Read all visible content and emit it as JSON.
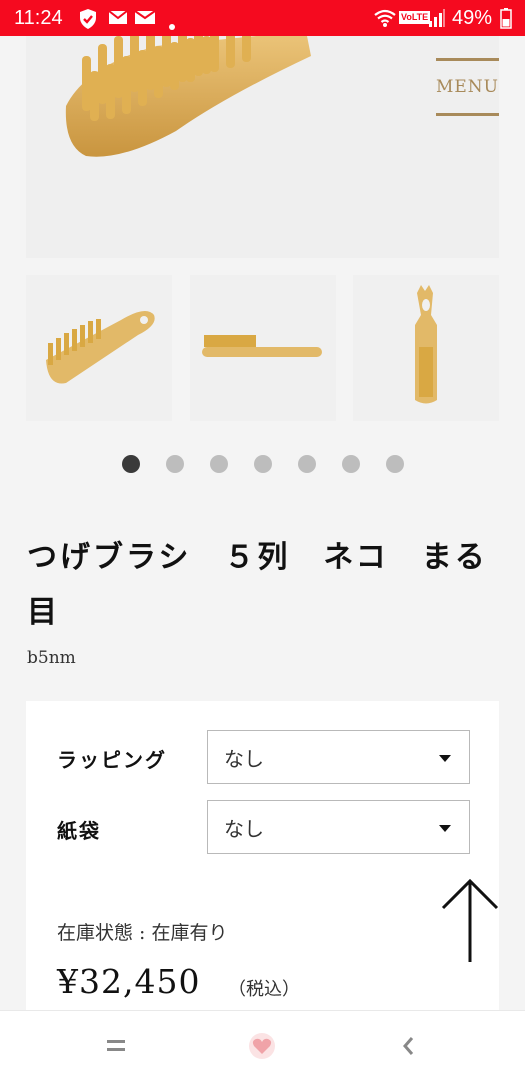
{
  "status_bar": {
    "time": "11:24",
    "volte": "VoLTE",
    "battery": "49%"
  },
  "header": {
    "menu_label": "MENU"
  },
  "gallery": {
    "dots": 7,
    "active_dot": 1
  },
  "product": {
    "title": "つげブラシ　５列　ネコ　まる目",
    "sku": "b5nm"
  },
  "options": [
    {
      "label": "ラッピング",
      "value": "なし"
    },
    {
      "label": "紙袋",
      "value": "なし"
    }
  ],
  "stock": {
    "label": "在庫状態 : 在庫有り"
  },
  "price": {
    "amount": "¥32,450",
    "tax_note": "（税込）"
  },
  "colors": {
    "status_bar": "#f50a1f",
    "accent_gold": "#a88a5a",
    "wood": "#e2b968",
    "heart": "#f0a3a8"
  }
}
